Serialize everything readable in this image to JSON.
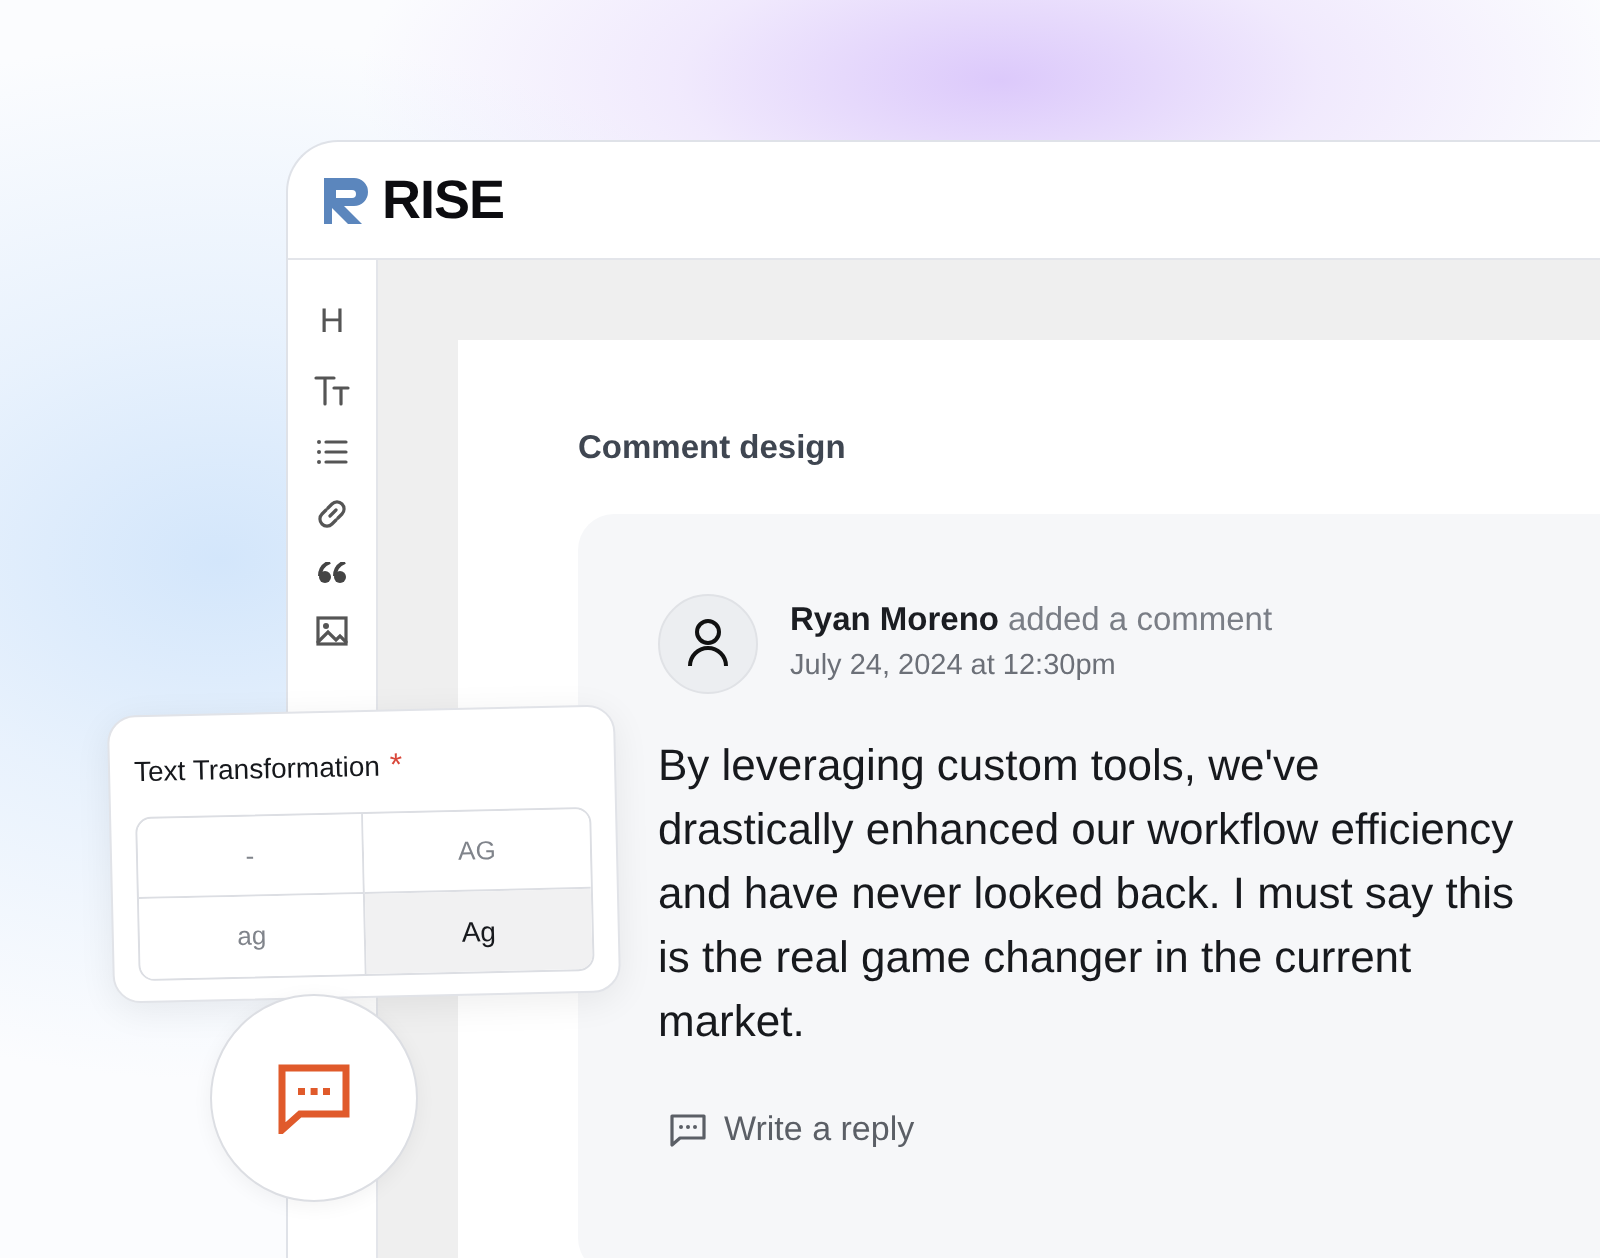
{
  "app": {
    "logo": "RISE"
  },
  "toolbar": [
    {
      "kind": "heading",
      "label": "H"
    },
    {
      "kind": "text-size"
    },
    {
      "kind": "list"
    },
    {
      "kind": "link"
    },
    {
      "kind": "quote"
    },
    {
      "kind": "image"
    }
  ],
  "document": {
    "section_title": "Comment design",
    "comment": {
      "author": "Ryan Moreno",
      "action": "added a comment",
      "date": "July 24, 2024 at 12:30pm",
      "body": "By leveraging custom tools, we've drastically enhanced our workflow efficiency and have never looked back. I must say this is the real game changer in the current market.",
      "reply": "Write a reply"
    }
  },
  "text_transformation": {
    "label": "Text Transformation",
    "required_mark": "*",
    "options": [
      {
        "label": "-",
        "selected": false
      },
      {
        "label": "AG",
        "selected": false
      },
      {
        "label": "ag",
        "selected": false
      },
      {
        "label": "Ag",
        "selected": true
      }
    ]
  }
}
